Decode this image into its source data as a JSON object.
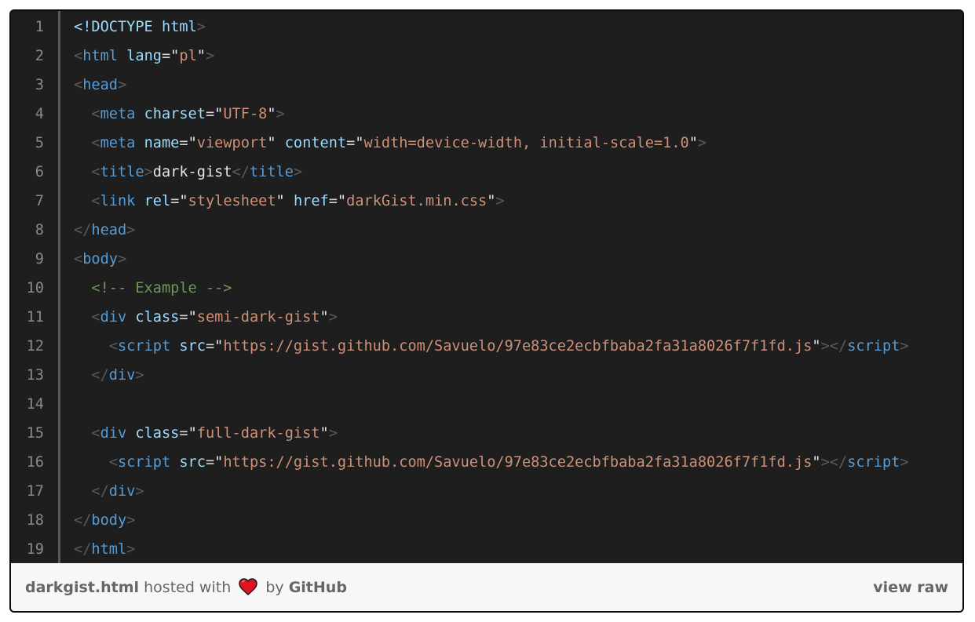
{
  "gist": {
    "lines": [
      {
        "n": "1",
        "tokens": [
          [
            "doc",
            "<!DOCTYPE html"
          ],
          [
            "br",
            ">"
          ]
        ]
      },
      {
        "n": "2",
        "tokens": [
          [
            "br",
            "<"
          ],
          [
            "tag",
            "html"
          ],
          [
            "txt",
            " "
          ],
          [
            "attr",
            "lang"
          ],
          [
            "eq",
            "="
          ],
          [
            "q",
            "\""
          ],
          [
            "str",
            "pl"
          ],
          [
            "q",
            "\""
          ],
          [
            "br",
            ">"
          ]
        ]
      },
      {
        "n": "3",
        "tokens": [
          [
            "br",
            "<"
          ],
          [
            "tag",
            "head"
          ],
          [
            "br",
            ">"
          ]
        ]
      },
      {
        "n": "4",
        "tokens": [
          [
            "txt",
            "  "
          ],
          [
            "br",
            "<"
          ],
          [
            "tag",
            "meta"
          ],
          [
            "txt",
            " "
          ],
          [
            "attr",
            "charset"
          ],
          [
            "eq",
            "="
          ],
          [
            "q",
            "\""
          ],
          [
            "str",
            "UTF-8"
          ],
          [
            "q",
            "\""
          ],
          [
            "br",
            ">"
          ]
        ]
      },
      {
        "n": "5",
        "tokens": [
          [
            "txt",
            "  "
          ],
          [
            "br",
            "<"
          ],
          [
            "tag",
            "meta"
          ],
          [
            "txt",
            " "
          ],
          [
            "attr",
            "name"
          ],
          [
            "eq",
            "="
          ],
          [
            "q",
            "\""
          ],
          [
            "str",
            "viewport"
          ],
          [
            "q",
            "\""
          ],
          [
            "txt",
            " "
          ],
          [
            "attr",
            "content"
          ],
          [
            "eq",
            "="
          ],
          [
            "q",
            "\""
          ],
          [
            "str",
            "width=device-width, initial-scale=1.0"
          ],
          [
            "q",
            "\""
          ],
          [
            "br",
            ">"
          ]
        ]
      },
      {
        "n": "6",
        "tokens": [
          [
            "txt",
            "  "
          ],
          [
            "br",
            "<"
          ],
          [
            "tag",
            "title"
          ],
          [
            "br",
            ">"
          ],
          [
            "txt",
            "dark-gist"
          ],
          [
            "br",
            "</"
          ],
          [
            "tag",
            "title"
          ],
          [
            "br",
            ">"
          ]
        ]
      },
      {
        "n": "7",
        "tokens": [
          [
            "txt",
            "  "
          ],
          [
            "br",
            "<"
          ],
          [
            "tag",
            "link"
          ],
          [
            "txt",
            " "
          ],
          [
            "attr",
            "rel"
          ],
          [
            "eq",
            "="
          ],
          [
            "q",
            "\""
          ],
          [
            "str",
            "stylesheet"
          ],
          [
            "q",
            "\""
          ],
          [
            "txt",
            " "
          ],
          [
            "attr",
            "href"
          ],
          [
            "eq",
            "="
          ],
          [
            "q",
            "\""
          ],
          [
            "str",
            "darkGist.min.css"
          ],
          [
            "q",
            "\""
          ],
          [
            "br",
            ">"
          ]
        ]
      },
      {
        "n": "8",
        "tokens": [
          [
            "br",
            "</"
          ],
          [
            "tag",
            "head"
          ],
          [
            "br",
            ">"
          ]
        ]
      },
      {
        "n": "9",
        "tokens": [
          [
            "br",
            "<"
          ],
          [
            "tag",
            "body"
          ],
          [
            "br",
            ">"
          ]
        ]
      },
      {
        "n": "10",
        "tokens": [
          [
            "txt",
            "  "
          ],
          [
            "cmt",
            "<!-- Example -->"
          ]
        ]
      },
      {
        "n": "11",
        "tokens": [
          [
            "txt",
            "  "
          ],
          [
            "br",
            "<"
          ],
          [
            "tag",
            "div"
          ],
          [
            "txt",
            " "
          ],
          [
            "attr",
            "class"
          ],
          [
            "eq",
            "="
          ],
          [
            "q",
            "\""
          ],
          [
            "str",
            "semi-dark-gist"
          ],
          [
            "q",
            "\""
          ],
          [
            "br",
            ">"
          ]
        ]
      },
      {
        "n": "12",
        "tokens": [
          [
            "txt",
            "    "
          ],
          [
            "br",
            "<"
          ],
          [
            "tag",
            "script"
          ],
          [
            "txt",
            " "
          ],
          [
            "attr",
            "src"
          ],
          [
            "eq",
            "="
          ],
          [
            "q",
            "\""
          ],
          [
            "str",
            "https://gist.github.com/Savuelo/97e83ce2ecbfbaba2fa31a8026f7f1fd.js"
          ],
          [
            "q",
            "\""
          ],
          [
            "br",
            "></"
          ],
          [
            "tag",
            "script"
          ],
          [
            "br",
            ">"
          ]
        ]
      },
      {
        "n": "13",
        "tokens": [
          [
            "txt",
            "  "
          ],
          [
            "br",
            "</"
          ],
          [
            "tag",
            "div"
          ],
          [
            "br",
            ">"
          ]
        ]
      },
      {
        "n": "14",
        "tokens": []
      },
      {
        "n": "15",
        "tokens": [
          [
            "txt",
            "  "
          ],
          [
            "br",
            "<"
          ],
          [
            "tag",
            "div"
          ],
          [
            "txt",
            " "
          ],
          [
            "attr",
            "class"
          ],
          [
            "eq",
            "="
          ],
          [
            "q",
            "\""
          ],
          [
            "str",
            "full-dark-gist"
          ],
          [
            "q",
            "\""
          ],
          [
            "br",
            ">"
          ]
        ]
      },
      {
        "n": "16",
        "tokens": [
          [
            "txt",
            "    "
          ],
          [
            "br",
            "<"
          ],
          [
            "tag",
            "script"
          ],
          [
            "txt",
            " "
          ],
          [
            "attr",
            "src"
          ],
          [
            "eq",
            "="
          ],
          [
            "q",
            "\""
          ],
          [
            "str",
            "https://gist.github.com/Savuelo/97e83ce2ecbfbaba2fa31a8026f7f1fd.js"
          ],
          [
            "q",
            "\""
          ],
          [
            "br",
            "></"
          ],
          [
            "tag",
            "script"
          ],
          [
            "br",
            ">"
          ]
        ]
      },
      {
        "n": "17",
        "tokens": [
          [
            "txt",
            "  "
          ],
          [
            "br",
            "</"
          ],
          [
            "tag",
            "div"
          ],
          [
            "br",
            ">"
          ]
        ]
      },
      {
        "n": "18",
        "tokens": [
          [
            "br",
            "</"
          ],
          [
            "tag",
            "body"
          ],
          [
            "br",
            ">"
          ]
        ]
      },
      {
        "n": "19",
        "tokens": [
          [
            "br",
            "</"
          ],
          [
            "tag",
            "html"
          ],
          [
            "br",
            ">"
          ]
        ]
      }
    ]
  },
  "footer": {
    "filename": "darkgist.html",
    "hosted_with": "hosted with",
    "heart_icon": "heart-icon",
    "by": "by",
    "host": "GitHub",
    "view_raw": "view raw"
  },
  "colors": {
    "code_bg": "#1e1e1e",
    "tag": "#569cd6",
    "attr": "#9cdcfe",
    "string": "#ce9178",
    "comment": "#6a9955",
    "bracket": "#5a5a5a",
    "footer_bg": "#f7f7f7",
    "heart": "#e0131e"
  }
}
